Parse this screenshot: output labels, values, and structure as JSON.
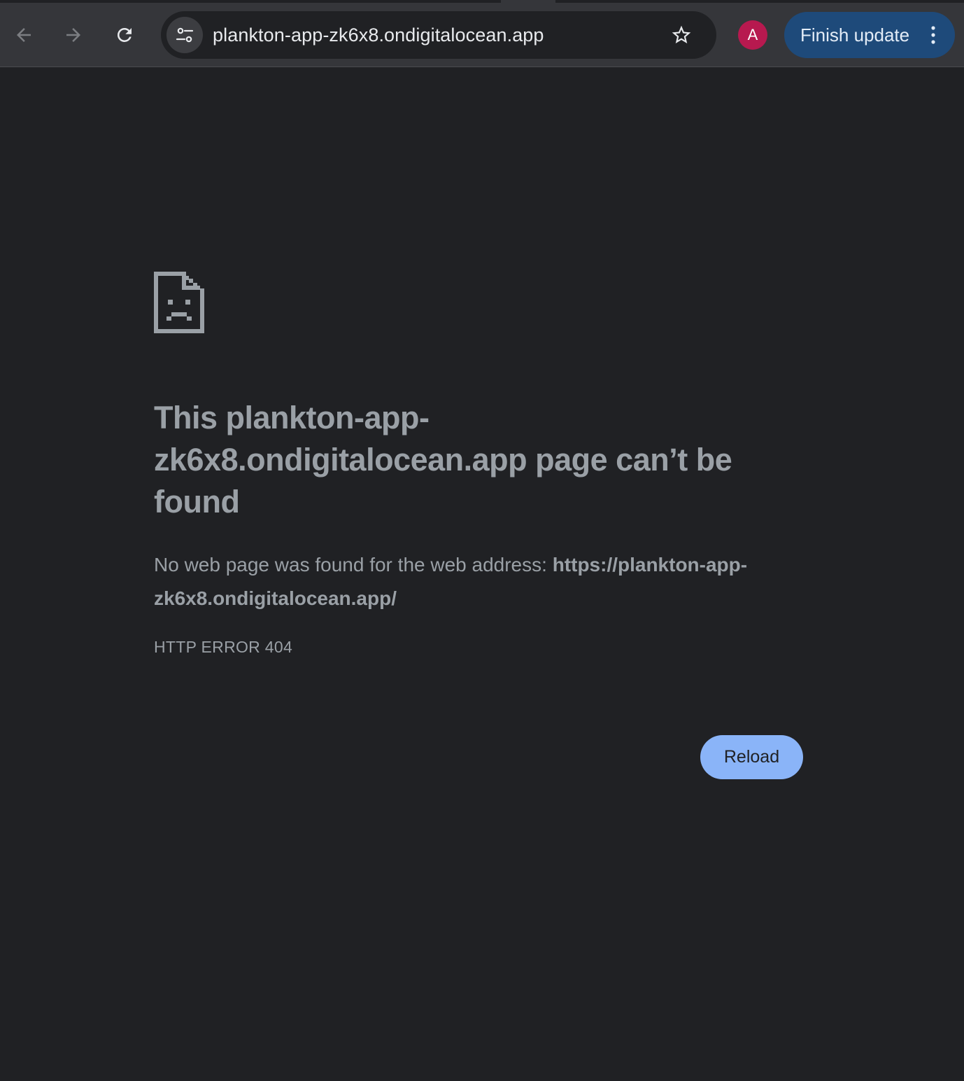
{
  "browser": {
    "nav": {
      "back_icon": "arrow-left-icon",
      "forward_icon": "arrow-right-icon",
      "reload_icon": "reload-icon"
    },
    "omnibox": {
      "site_info_icon": "tune-icon",
      "url": "plankton-app-zk6x8.ondigitalocean.app",
      "bookmark_icon": "star-outline-icon"
    },
    "profile": {
      "initial": "A",
      "color": "#b7194f"
    },
    "update_button": {
      "label": "Finish update",
      "menu_icon": "more-vertical-icon",
      "color": "#1e4a7a"
    }
  },
  "error_page": {
    "icon": "sad-page-icon",
    "title": "This plankton-app-zk6x8.ondigitalocean.app page can’t be found",
    "description_prefix": "No web page was found for the web address: ",
    "description_url": "https://plankton-app-zk6x8.ondigitalocean.app/",
    "error_code": "HTTP ERROR 404",
    "reload_label": "Reload",
    "accent_color": "#8ab4f8"
  }
}
